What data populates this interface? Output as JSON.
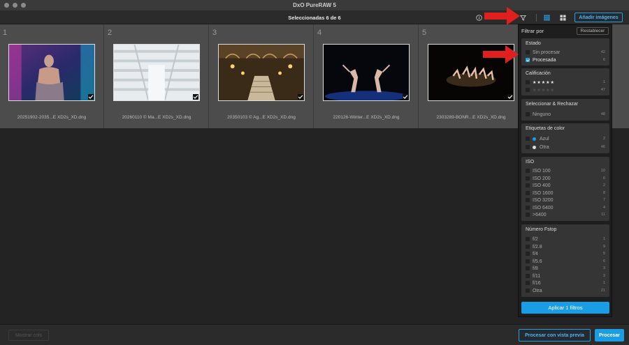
{
  "window": {
    "title": "DxO PureRAW 5"
  },
  "toolbar": {
    "selection_text": "Seleccionadas 6 de 6",
    "add_images_label": "Añadir imágenes",
    "icons": [
      "info-icon",
      "filter-icon",
      "grid-view-icon",
      "compare-view-icon"
    ]
  },
  "images": [
    {
      "number": "1",
      "filename": "20251902-2035...E XD2s_XD.dng",
      "selected": true
    },
    {
      "number": "2",
      "filename": "20260110 © Ma...E XD2s_XD.dng",
      "selected": true
    },
    {
      "number": "3",
      "filename": "20350103 © Ag...E XD2s_XD.dng",
      "selected": true
    },
    {
      "number": "4",
      "filename": "220126-Winter...E XD2s_XD.dng",
      "selected": true
    },
    {
      "number": "5",
      "filename": "2303289-BONR...E XD2s_XD.dng",
      "selected": true
    }
  ],
  "filter_panel": {
    "title": "Filtrar por",
    "reset_label": "Restablecer",
    "apply_label": "Aplicar 1 filtros",
    "sections": {
      "estado": {
        "title": "Estado",
        "options": [
          {
            "label": "Sin procesar",
            "count": "42",
            "checked": false
          },
          {
            "label": "Procesada",
            "count": "6",
            "checked": true
          }
        ]
      },
      "calificacion": {
        "title": "Calificación",
        "options": [
          {
            "label": "★★★★★",
            "count": "1",
            "checked": false
          },
          {
            "label": "★★★★★",
            "count": "47",
            "checked": false
          }
        ]
      },
      "seleccionar": {
        "title": "Seleccionar & Rechazar",
        "options": [
          {
            "label": "Ninguno",
            "count": "48",
            "checked": false
          }
        ]
      },
      "etiquetas": {
        "title": "Etiquetas de color",
        "options": [
          {
            "label": "Azul",
            "count": "2",
            "checked": false,
            "color": "#1a9de4"
          },
          {
            "label": "Otra",
            "count": "46",
            "checked": false,
            "color": "#dddddd"
          }
        ]
      },
      "iso": {
        "title": "ISO",
        "options": [
          {
            "label": "ISO 100",
            "count": "10"
          },
          {
            "label": "ISO 200",
            "count": "6"
          },
          {
            "label": "ISO 400",
            "count": "2"
          },
          {
            "label": "ISO 1600",
            "count": "8"
          },
          {
            "label": "ISO 3200",
            "count": "7"
          },
          {
            "label": "ISO 6400",
            "count": "4"
          },
          {
            "label": ">6400",
            "count": "11"
          }
        ]
      },
      "fstop": {
        "title": "Número Fstop",
        "options": [
          {
            "label": "f/2",
            "count": "1"
          },
          {
            "label": "f/2.8",
            "count": "9"
          },
          {
            "label": "f/4",
            "count": "5"
          },
          {
            "label": "f/5.6",
            "count": "6"
          },
          {
            "label": "f/8",
            "count": "3"
          },
          {
            "label": "f/11",
            "count": "3"
          },
          {
            "label": "f/16",
            "count": "1"
          },
          {
            "label": "Otra",
            "count": "21"
          }
        ]
      }
    }
  },
  "bottom": {
    "show_columns_label": "Mostrar cols",
    "preview_process_label": "Procesar con vista previa",
    "process_label": "Procesar"
  },
  "colors": {
    "accent": "#1a9de4",
    "annotation_arrow": "#e0201e"
  }
}
